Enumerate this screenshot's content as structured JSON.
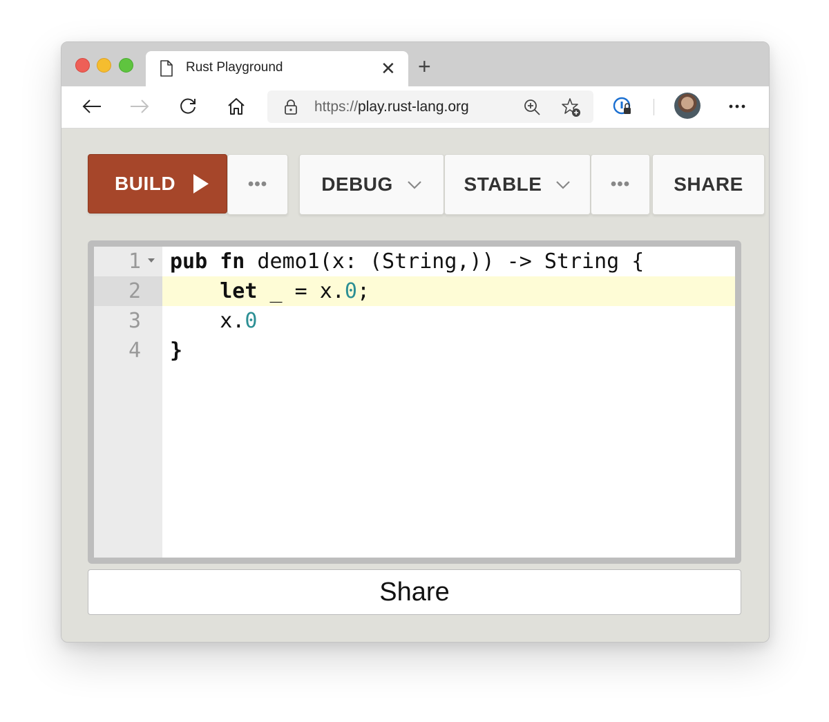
{
  "browser": {
    "tab_title": "Rust Playground",
    "close_glyph": "✕",
    "new_tab_glyph": "+",
    "url_scheme": "https://",
    "url_host": "play.rust-lang.org"
  },
  "toolbar": {
    "build_label": "BUILD",
    "more_label": "•••",
    "debug_label": "DEBUG",
    "stable_label": "STABLE",
    "share_label": "SHARE"
  },
  "editor": {
    "lines": [
      {
        "number": "1"
      },
      {
        "number": "2"
      },
      {
        "number": "3"
      },
      {
        "number": "4"
      }
    ],
    "tokens": {
      "l1_kw": "pub fn",
      "l1_rest": " demo1(x: (String,)) -> String {",
      "l2_indent": "    ",
      "l2_kw": "let",
      "l2_rest": " _ = x.",
      "l2_num": "0",
      "l2_end": ";",
      "l3_indent": "    x.",
      "l3_num": "0",
      "l4": "}"
    }
  },
  "share_bar": {
    "label": "Share"
  },
  "colors": {
    "build": "#a6462a",
    "number_literal": "#2c8f94",
    "active_line": "#fefcd6"
  }
}
